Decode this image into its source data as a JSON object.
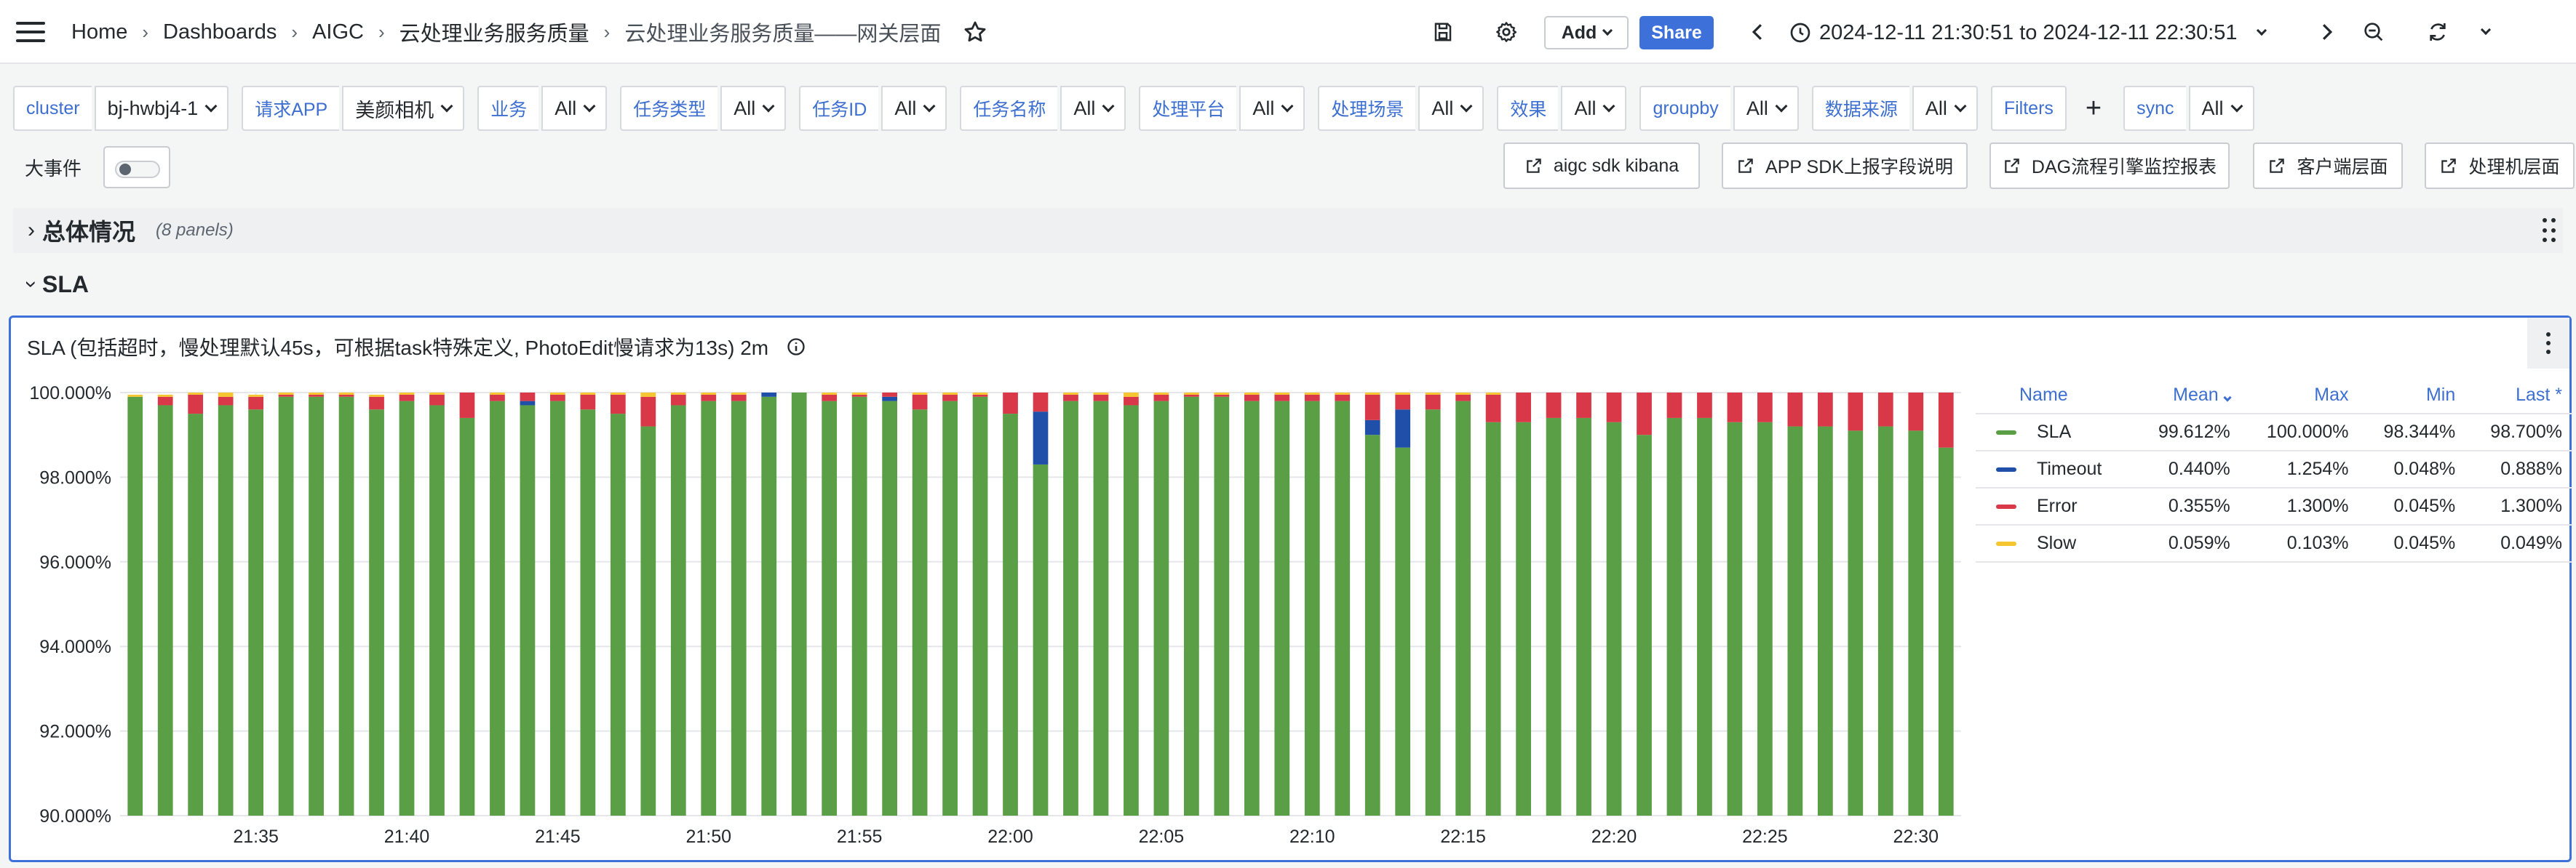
{
  "breadcrumb": {
    "items": [
      "Home",
      "Dashboards",
      "AIGC",
      "云处理业务服务质量",
      "云处理业务服务质量——网关层面"
    ],
    "separator": "›"
  },
  "toolbar": {
    "add_label": "Add",
    "share_label": "Share",
    "time_range": "2024-12-11 21:30:51 to 2024-12-11 22:30:51",
    "icons": [
      "save-icon",
      "gear-icon",
      "chevron-left-icon",
      "clock-icon",
      "chevron-down-icon",
      "chevron-right-icon",
      "zoom-out-icon",
      "refresh-icon"
    ]
  },
  "variables": [
    {
      "label": "cluster",
      "value": "bj-hwbj4-1"
    },
    {
      "label": "请求APP",
      "value": "美颜相机"
    },
    {
      "label": "业务",
      "value": "All"
    },
    {
      "label": "任务类型",
      "value": "All"
    },
    {
      "label": "任务ID",
      "value": "All"
    },
    {
      "label": "任务名称",
      "value": "All"
    },
    {
      "label": "处理平台",
      "value": "All"
    },
    {
      "label": "处理场景",
      "value": "All"
    },
    {
      "label": "效果",
      "value": "All"
    },
    {
      "label": "groupby",
      "value": "All"
    },
    {
      "label": "数据来源",
      "value": "All"
    }
  ],
  "filters_label": "Filters",
  "sync": {
    "label": "sync",
    "value": "All"
  },
  "events": {
    "label": "大事件",
    "toggle_on": false
  },
  "links": [
    "aigc sdk kibana",
    "APP SDK上报字段说明",
    "DAG流程引擎监控报表",
    "客户端层面",
    "处理机层面"
  ],
  "rows": [
    {
      "title": "总体情况",
      "subtitle": "(8 panels)",
      "collapsed": true
    },
    {
      "title": "SLA",
      "collapsed": false
    }
  ],
  "panel": {
    "title": "SLA (包括超时，慢处理默认45s，可根据task特殊定义, PhotoEdit慢请求为13s) 2m"
  },
  "legend": {
    "headers": [
      "Name",
      "Mean",
      "Max",
      "Min",
      "Last *"
    ],
    "rows": [
      {
        "name": "SLA",
        "color": "#5a9e45",
        "mean": "99.612%",
        "max": "100.000%",
        "min": "98.344%",
        "last": "98.700%"
      },
      {
        "name": "Timeout",
        "color": "#1f4fa8",
        "mean": "0.440%",
        "max": "1.254%",
        "min": "0.048%",
        "last": "0.888%"
      },
      {
        "name": "Error",
        "color": "#d93848",
        "mean": "0.355%",
        "max": "1.300%",
        "min": "0.045%",
        "last": "1.300%"
      },
      {
        "name": "Slow",
        "color": "#f5c630",
        "mean": "0.059%",
        "max": "0.103%",
        "min": "0.045%",
        "last": "0.049%"
      }
    ]
  },
  "chart_data": {
    "type": "bar",
    "stacked": true,
    "ylim": [
      90,
      100
    ],
    "y_ticks": [
      "100.000%",
      "98.000%",
      "96.000%",
      "94.000%",
      "92.000%",
      "90.000%"
    ],
    "x_ticks": [
      "21:35",
      "21:40",
      "21:45",
      "21:50",
      "21:55",
      "22:00",
      "22:05",
      "22:10",
      "22:15",
      "22:20",
      "22:25",
      "22:30"
    ],
    "grid": true,
    "legend_placement": "right",
    "series": [
      {
        "name": "SLA",
        "color": "#5a9e45",
        "values": [
          99.9,
          99.7,
          99.5,
          99.7,
          99.6,
          99.9,
          99.9,
          99.9,
          99.6,
          99.8,
          99.7,
          99.4,
          99.8,
          99.7,
          99.8,
          99.6,
          99.5,
          99.2,
          99.7,
          99.8,
          99.8,
          99.9,
          100.0,
          99.8,
          99.9,
          99.8,
          99.6,
          99.8,
          99.9,
          99.5,
          98.3,
          99.8,
          99.8,
          99.7,
          99.8,
          99.9,
          99.9,
          99.8,
          99.8,
          99.8,
          99.8,
          99.0,
          98.7,
          99.6,
          99.8,
          99.3,
          99.3,
          99.4,
          99.4,
          99.3,
          99.0,
          99.4,
          99.4,
          99.3,
          99.3,
          99.2,
          99.2,
          99.1,
          99.2,
          99.1,
          98.7
        ]
      },
      {
        "name": "Timeout",
        "color": "#1f4fa8",
        "values": [
          0,
          0,
          0,
          0,
          0,
          0,
          0,
          0,
          0,
          0,
          0,
          0,
          0,
          0.1,
          0,
          0,
          0,
          0,
          0,
          0,
          0,
          0.1,
          0,
          0,
          0,
          0.1,
          0,
          0,
          0,
          0,
          1.25,
          0,
          0,
          0,
          0,
          0,
          0,
          0,
          0,
          0,
          0,
          0.35,
          0.9,
          0,
          0,
          0,
          0,
          0,
          0,
          0,
          0,
          0,
          0,
          0,
          0,
          0,
          0,
          0,
          0,
          0,
          0
        ]
      },
      {
        "name": "Error",
        "color": "#d93848",
        "values": [
          0,
          0.2,
          0.45,
          0.2,
          0.3,
          0.05,
          0.05,
          0.05,
          0.3,
          0.15,
          0.25,
          0.6,
          0.15,
          0.2,
          0.15,
          0.35,
          0.45,
          0.7,
          0.25,
          0.15,
          0.15,
          0,
          0,
          0.15,
          0.05,
          0.1,
          0.35,
          0.15,
          0.05,
          0.5,
          0.45,
          0.15,
          0.15,
          0.2,
          0.15,
          0.05,
          0.05,
          0.15,
          0.15,
          0.15,
          0.15,
          0.6,
          0.35,
          0.35,
          0.15,
          0.65,
          0.7,
          0.6,
          0.6,
          0.7,
          1.0,
          0.6,
          0.6,
          0.7,
          0.7,
          0.8,
          0.8,
          0.9,
          0.8,
          0.9,
          1.3
        ]
      },
      {
        "name": "Slow",
        "color": "#f5c630",
        "values": [
          0.05,
          0.05,
          0.05,
          0.1,
          0.05,
          0.05,
          0.05,
          0.05,
          0.05,
          0.05,
          0.05,
          0.05,
          0.05,
          0.05,
          0.05,
          0.05,
          0.05,
          0.1,
          0.05,
          0.05,
          0.05,
          0.05,
          0.05,
          0.1,
          0.05,
          0.05,
          0.05,
          0.05,
          0.05,
          0.05,
          0.05,
          0.05,
          0.05,
          0.1,
          0.05,
          0.05,
          0.05,
          0.05,
          0.05,
          0.05,
          0.05,
          0.05,
          0.05,
          0.05,
          0.05,
          0.05,
          0.05,
          0.05,
          0.05,
          0.05,
          0.05,
          0.05,
          0.05,
          0.05,
          0.05,
          0.05,
          0.05,
          0.05,
          0.05,
          0.05,
          0.05
        ]
      }
    ]
  }
}
